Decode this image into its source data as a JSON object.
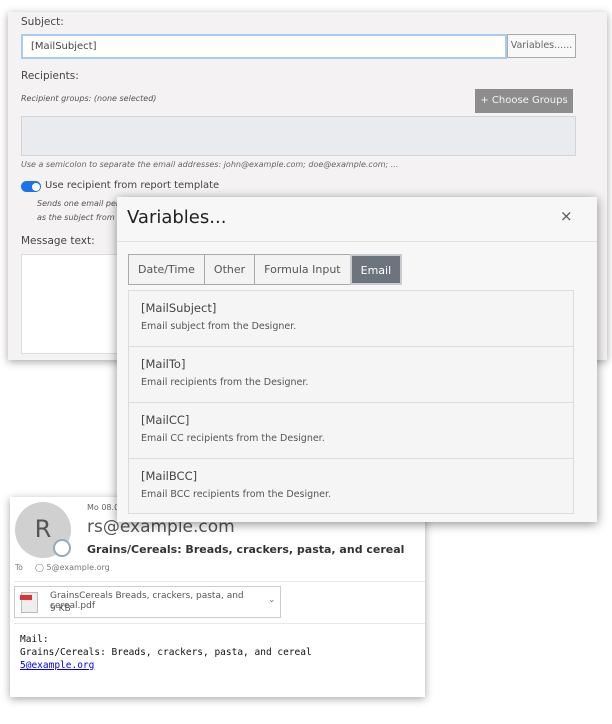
{
  "form": {
    "subject_label": "Subject:",
    "subject_value": "[MailSubject]",
    "variables_button": "Variables......",
    "recipients_label": "Recipients:",
    "recipient_groups": "Recipient groups: (none selected)",
    "choose_groups": "+ Choose Groups",
    "hint": "Use a semicolon to separate the email addresses: john@example.com; doe@example.com; ...",
    "toggle_label": "Use recipient from report template",
    "toggle_on": true,
    "toggle_desc1": "Sends one email per",
    "toggle_desc2": "as the subject from th",
    "message_label": "Message text:",
    "accent": "#1a73e8"
  },
  "modal": {
    "title": "Variables...",
    "close": "×",
    "tabs": [
      {
        "label": "Date/Time"
      },
      {
        "label": "Other"
      },
      {
        "label": "Formula Input"
      },
      {
        "label": "Email",
        "active": true
      }
    ],
    "items": [
      {
        "name": "[MailSubject]",
        "desc": "Email subject from the Designer."
      },
      {
        "name": "[MailTo]",
        "desc": "Email recipients from the Designer."
      },
      {
        "name": "[MailCC]",
        "desc": "Email CC recipients from the Designer."
      },
      {
        "name": "[MailBCC]",
        "desc": "Email BCC recipients from the Designer."
      }
    ]
  },
  "mail": {
    "avatar": "R",
    "date": "Mo 08.0",
    "from": "rs@example.com",
    "subject": "Grains/Cereals: Breads, crackers, pasta, and cereal",
    "to_label": "To",
    "to": "5@example.org",
    "attachment": {
      "name": "GrainsCereals Breads, crackers, pasta, and cereal.pdf",
      "size": "9 KB",
      "icon": "pdf-icon"
    },
    "body_line1": "Mail:",
    "body_line2": "Grains/Cereals: Breads, crackers, pasta, and cereal",
    "body_link": "5@example.org"
  }
}
